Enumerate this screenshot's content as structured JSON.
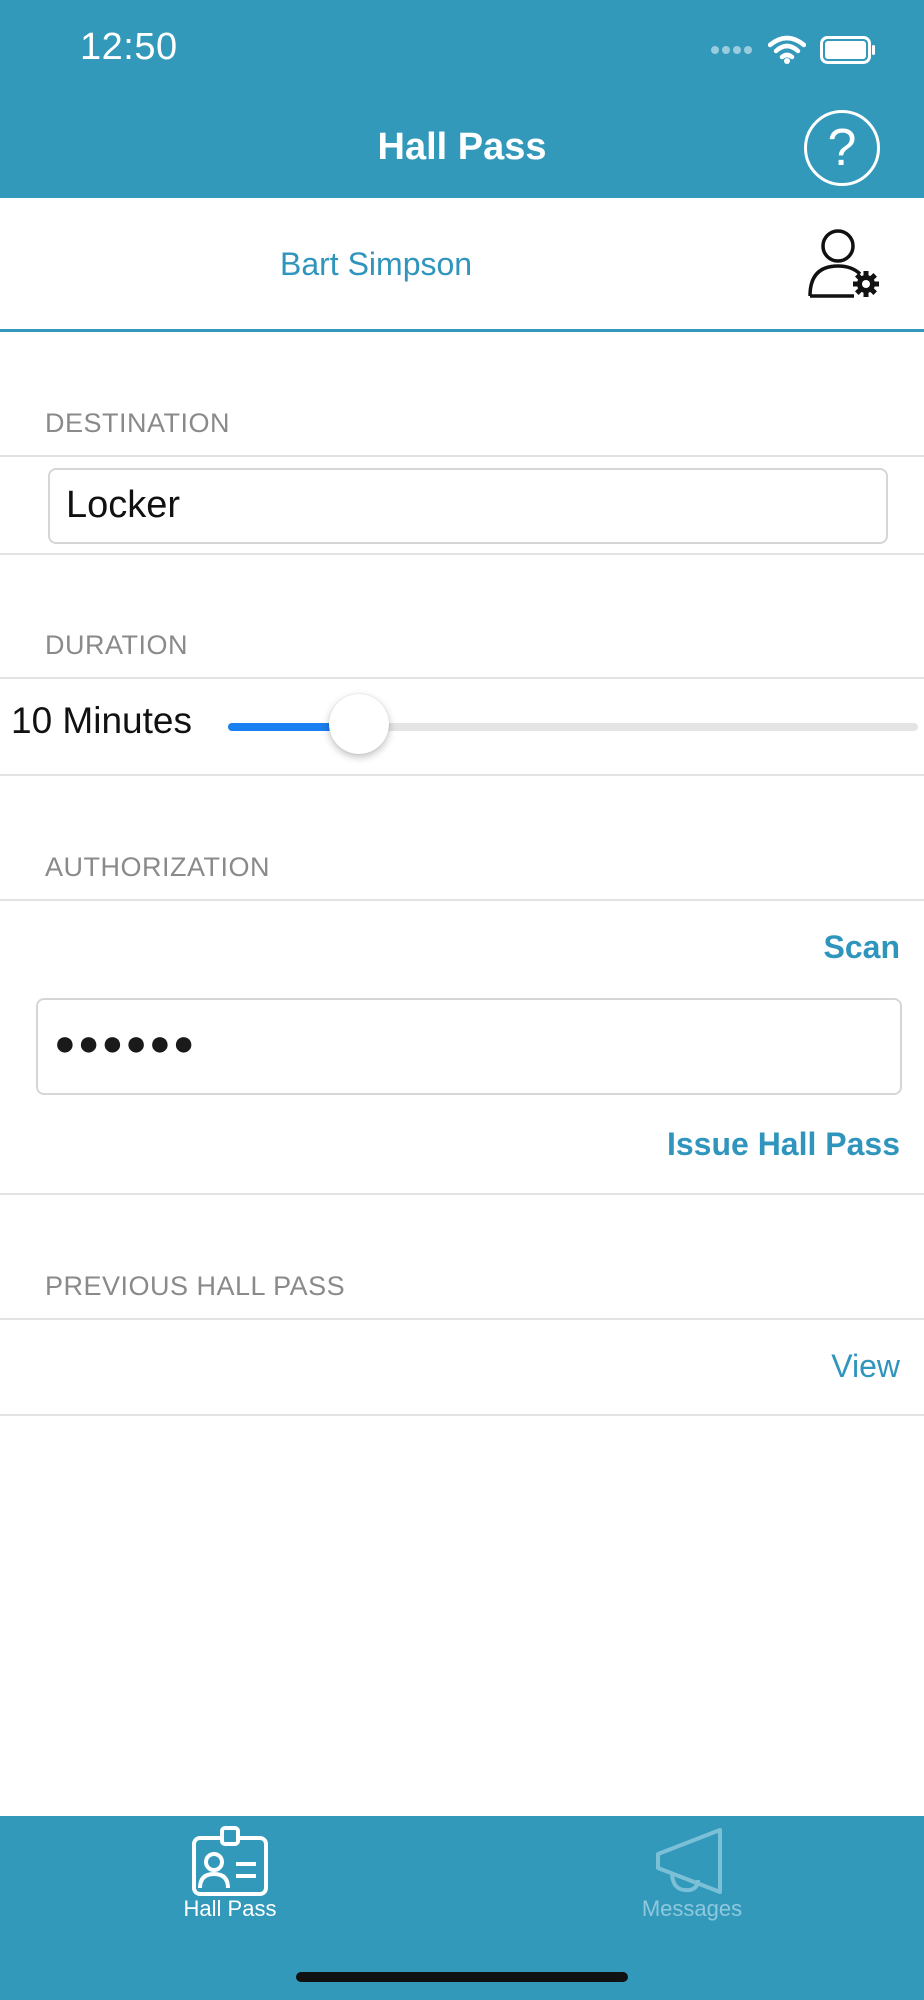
{
  "status_bar": {
    "time": "12:50"
  },
  "nav": {
    "title": "Hall Pass",
    "help_icon": "question-circle-icon"
  },
  "user": {
    "name": "Bart Simpson",
    "settings_icon": "user-gear-icon"
  },
  "destination": {
    "label": "DESTINATION",
    "value": "Locker"
  },
  "duration": {
    "label": "DURATION",
    "value_text": "10 Minutes",
    "slider_fraction": 0.19
  },
  "authorization": {
    "label": "AUTHORIZATION",
    "scan_label": "Scan",
    "password_value": "●●●●●●",
    "issue_label": "Issue Hall Pass"
  },
  "previous": {
    "label": "PREVIOUS HALL PASS",
    "view_label": "View"
  },
  "tabs": [
    {
      "label": "Hall Pass",
      "icon": "id-badge-icon",
      "active": true
    },
    {
      "label": "Messages",
      "icon": "megaphone-icon",
      "active": false
    }
  ],
  "colors": {
    "brand": "#3399bb",
    "accent": "#2f95bd",
    "slider": "#1a7ff0"
  }
}
